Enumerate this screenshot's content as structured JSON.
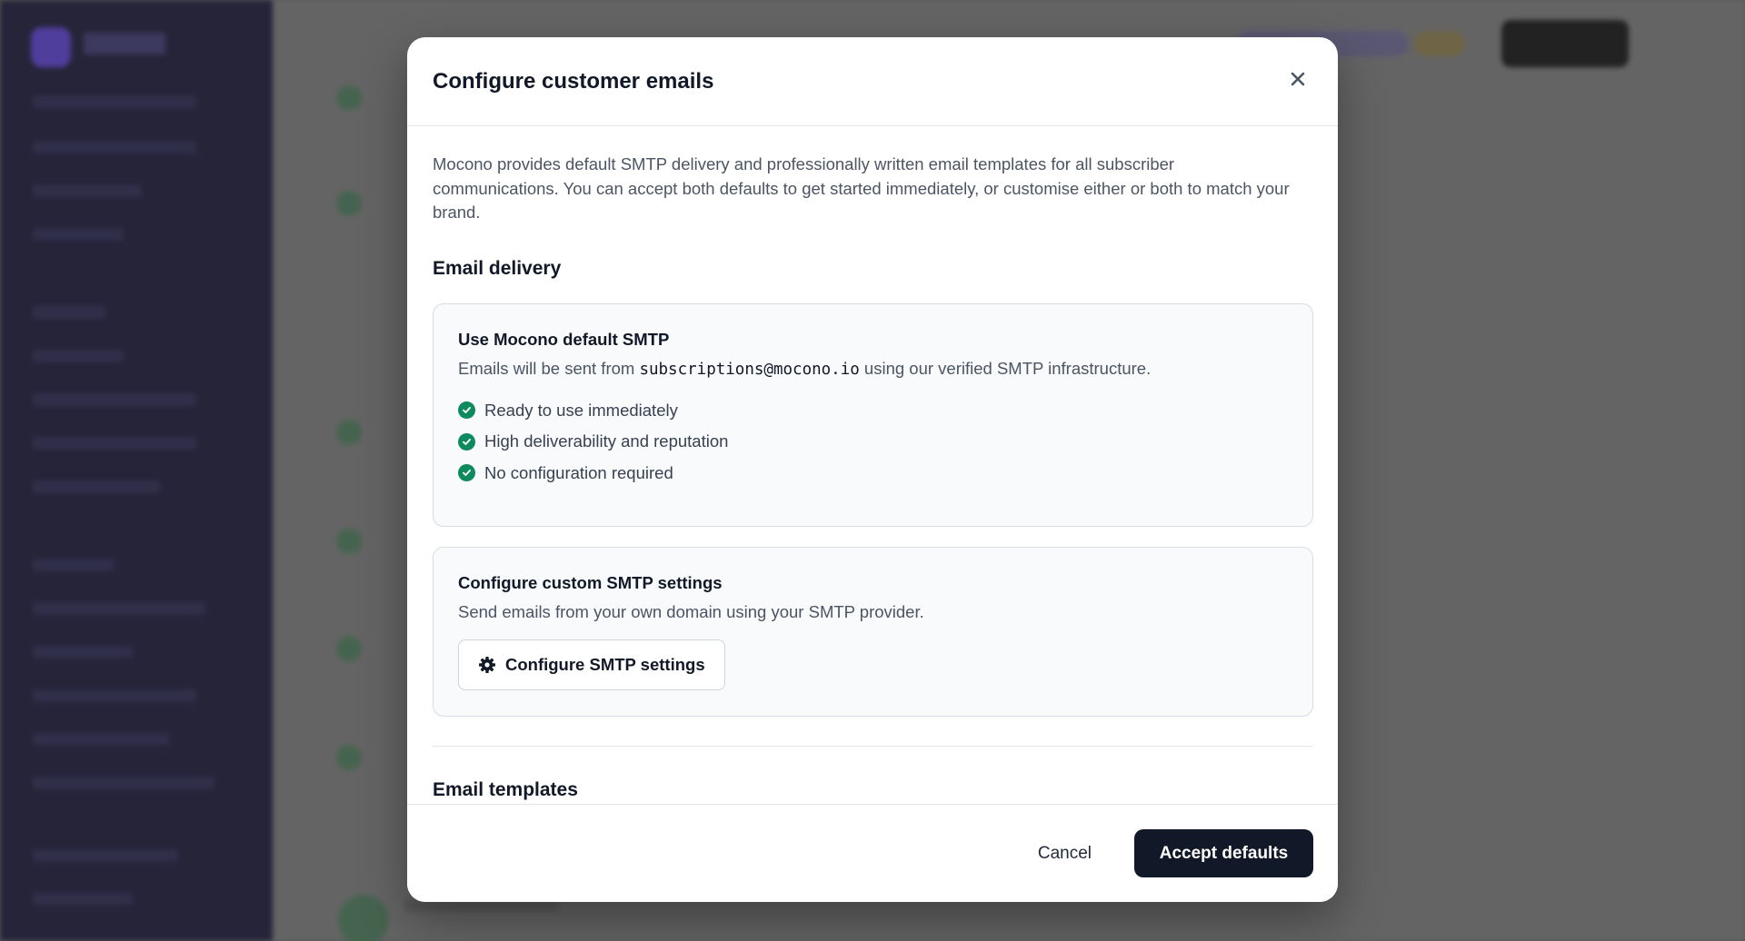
{
  "modal": {
    "title": "Configure customer emails",
    "intro": "Mocono provides default SMTP delivery and professionally written email templates for all subscriber communications. You can accept both defaults to get started immediately, or customise either or both to match your brand.",
    "close_icon": "close-icon"
  },
  "email_delivery": {
    "section_title": "Email delivery",
    "default_smtp": {
      "title": "Use Mocono default SMTP",
      "desc_prefix": "Emails will be sent from ",
      "sender_address": "subscriptions@mocono.io",
      "desc_suffix": " using our verified SMTP infrastructure.",
      "features": [
        "Ready to use immediately",
        "High deliverability and reputation",
        "No configuration required"
      ],
      "feature_icon": "check-circle-icon",
      "accent_color": "#0e8a5f"
    },
    "custom_smtp": {
      "title": "Configure custom SMTP settings",
      "desc": "Send emails from your own domain using your SMTP provider.",
      "button_label": "Configure SMTP settings",
      "button_icon": "gear-icon"
    }
  },
  "email_templates": {
    "section_title": "Email templates"
  },
  "footer": {
    "cancel_label": "Cancel",
    "accept_label": "Accept defaults",
    "accept_color": "#111827"
  }
}
